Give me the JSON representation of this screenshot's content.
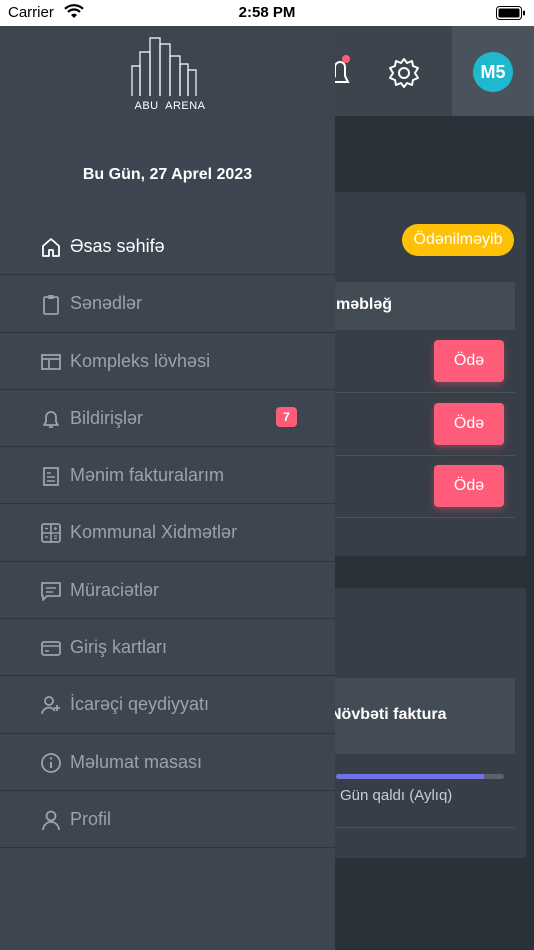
{
  "status_bar": {
    "carrier": "Carrier",
    "time": "2:58 PM"
  },
  "header": {
    "avatar_initials": "M5"
  },
  "background": {
    "unpaid_badge": "Ödənilməyib",
    "amount_header": "məbləğ",
    "pay_buttons": [
      "Ödə",
      "Ödə",
      "Ödə"
    ],
    "next_invoice": "Növbəti faktura",
    "days_left": "Gün qaldı (Aylıq)",
    "progress_fraction": 0.88
  },
  "drawer": {
    "logo_text": "ABU  ARENA",
    "date": "Bu Gün, 27 Aprel 2023",
    "items": [
      {
        "label": "Əsas səhifə",
        "icon": "home-icon",
        "active": true
      },
      {
        "label": "Sənədlər",
        "icon": "clipboard-icon"
      },
      {
        "label": "Kompleks lövhəsi",
        "icon": "board-icon"
      },
      {
        "label": "Bildirişlər",
        "icon": "bell-icon",
        "count": "7"
      },
      {
        "label": "Mənim fakturalarım",
        "icon": "invoice-icon"
      },
      {
        "label": "Kommunal Xidmətlər",
        "icon": "calculator-icon"
      },
      {
        "label": "Müraciətlər",
        "icon": "message-icon"
      },
      {
        "label": "Giriş kartları",
        "icon": "card-icon"
      },
      {
        "label": "İcarəçi qeydiyyatı",
        "icon": "add-user-icon"
      },
      {
        "label": "Məlumat masası",
        "icon": "info-icon"
      },
      {
        "label": "Profil",
        "icon": "user-icon"
      }
    ]
  },
  "colors": {
    "accent_pink": "#ff5c7a",
    "warning": "#ffc107",
    "avatar": "#1fb9cf",
    "progress": "#6d74e6"
  }
}
